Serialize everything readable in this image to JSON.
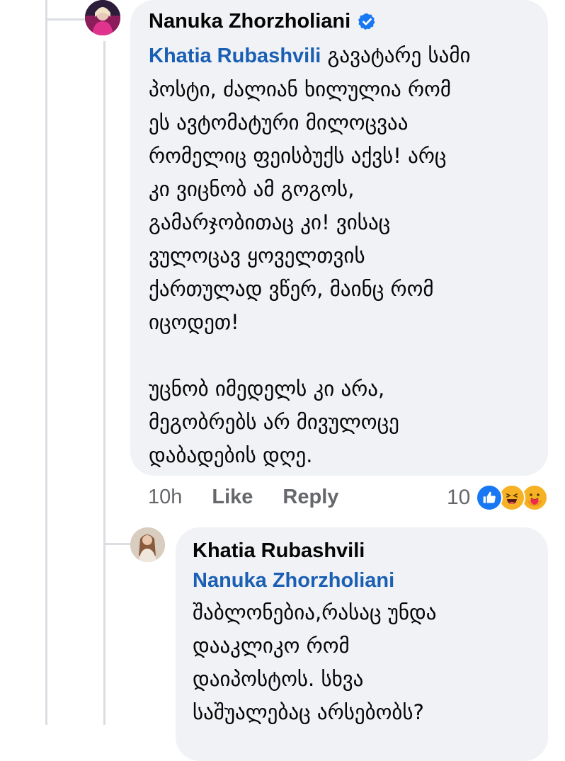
{
  "comment": {
    "author": "Nanuka Zhorzholiani",
    "verified_icon": "verified-badge-icon",
    "mention": "Khatia Rubashvili",
    "paragraph1": [
      "გავატარე სამი",
      "პოსტი, ძალიან ხილულია რომ",
      "ეს ავტომატური მილოცვაა",
      "რომელიც ფეისბუქს აქვს! არც",
      "კი ვიცნობ ამ გოგოს,",
      "გამარჯობითაც კი! ვისაც",
      "ვულოცავ ყოველთვის",
      "ქართულად ვწერ, მაინც რომ",
      "იცოდეთ!"
    ],
    "paragraph2": [
      "უცნობ იმედელს კი არა,",
      "მეგობრებს არ მივულოცე",
      "დაბადების დღე."
    ],
    "time": "10h",
    "like_label": "Like",
    "reply_label": "Reply",
    "reaction_count": "10",
    "reaction_icons": [
      "like-reaction-icon",
      "haha-reaction-icon",
      "care-reaction-icon"
    ]
  },
  "reply": {
    "author": "Khatia Rubashvili",
    "mention": "Nanuka Zhorzholiani",
    "lines": [
      "შაბლონებია,რასაც უნდა",
      "დააკლიკო რომ",
      "დაიპოსტოს. სხვა",
      "საშუალებაც არსებობს?"
    ]
  },
  "colors": {
    "bubble": "#f0f2f5",
    "mention": "#1a5fb4",
    "secondary_text": "#65676b",
    "verified": "#1877f2",
    "like_reaction": "#1877f2",
    "haha_reaction": "#f7b125"
  }
}
